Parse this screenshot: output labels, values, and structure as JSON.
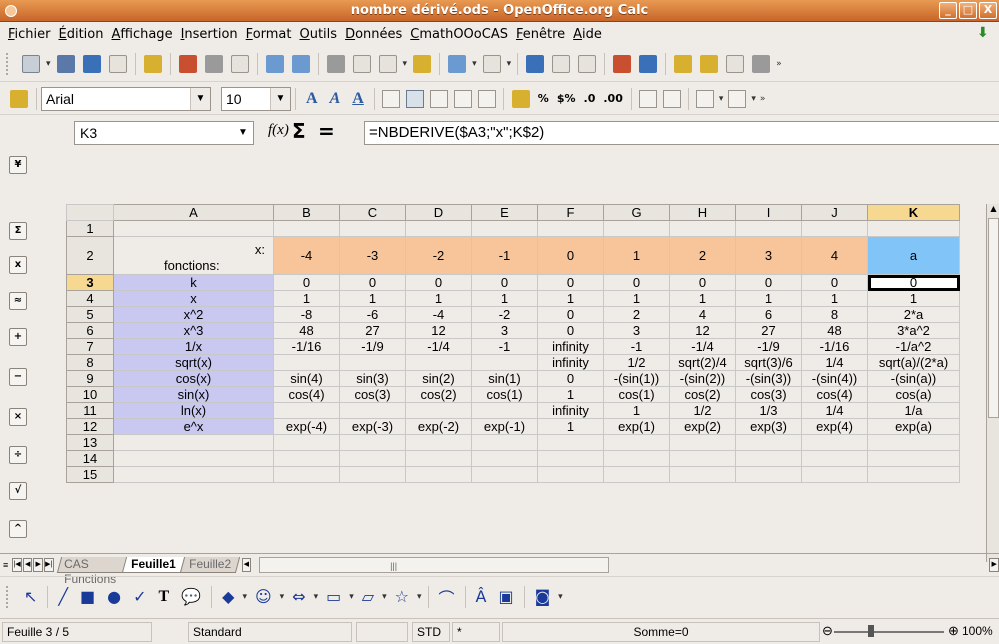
{
  "window": {
    "title": "nombre dérivé.ods - OpenOffice.org Calc",
    "buttons": [
      "_",
      "□",
      "X"
    ]
  },
  "menu": [
    "Fichier",
    "Édition",
    "Affichage",
    "Insertion",
    "Format",
    "Outils",
    "Données",
    "CmathOOoCAS",
    "Fenêtre",
    "Aide"
  ],
  "format": {
    "font": "Arial",
    "size": "10"
  },
  "formula": {
    "cell": "K3",
    "fx": "f(x)",
    "sigma": "Σ",
    "equals": "=",
    "content": "=NBDERIVE($A3;\"x\";K$2)"
  },
  "grid": {
    "columns": [
      "A",
      "B",
      "C",
      "D",
      "E",
      "F",
      "G",
      "H",
      "I",
      "J",
      "K"
    ],
    "row_labels": [
      "1",
      "2",
      "3",
      "4",
      "5",
      "6",
      "7",
      "8",
      "9",
      "10",
      "11",
      "12",
      "13",
      "14",
      "15"
    ],
    "a2_x": "x:",
    "a2_fonctions": "fonctions:",
    "row2": [
      "-4",
      "-3",
      "-2",
      "-1",
      "0",
      "1",
      "2",
      "3",
      "4",
      "a"
    ],
    "functions": [
      "k",
      "x",
      "x^2",
      "x^3",
      "1/x",
      "sqrt(x)",
      "cos(x)",
      "sin(x)",
      "ln(x)",
      "e^x"
    ],
    "values": [
      [
        "0",
        "0",
        "0",
        "0",
        "0",
        "0",
        "0",
        "0",
        "0",
        "0"
      ],
      [
        "1",
        "1",
        "1",
        "1",
        "1",
        "1",
        "1",
        "1",
        "1",
        "1"
      ],
      [
        "-8",
        "-6",
        "-4",
        "-2",
        "0",
        "2",
        "4",
        "6",
        "8",
        "2*a"
      ],
      [
        "48",
        "27",
        "12",
        "3",
        "0",
        "3",
        "12",
        "27",
        "48",
        "3*a^2"
      ],
      [
        "-1/16",
        "-1/9",
        "-1/4",
        "-1",
        "infinity",
        "-1",
        "-1/4",
        "-1/9",
        "-1/16",
        "-1/a^2"
      ],
      [
        "",
        "",
        "",
        "",
        "infinity",
        "1/2",
        "sqrt(2)/4",
        "sqrt(3)/6",
        "1/4",
        "sqrt(a)/(2*a)"
      ],
      [
        "sin(4)",
        "sin(3)",
        "sin(2)",
        "sin(1)",
        "0",
        "-(sin(1))",
        "-(sin(2))",
        "-(sin(3))",
        "-(sin(4))",
        "-(sin(a))"
      ],
      [
        "cos(4)",
        "cos(3)",
        "cos(2)",
        "cos(1)",
        "1",
        "cos(1)",
        "cos(2)",
        "cos(3)",
        "cos(4)",
        "cos(a)"
      ],
      [
        "",
        "",
        "",
        "",
        "infinity",
        "1",
        "1/2",
        "1/3",
        "1/4",
        "1/a"
      ],
      [
        "exp(-4)",
        "exp(-3)",
        "exp(-2)",
        "exp(-1)",
        "1",
        "exp(1)",
        "exp(2)",
        "exp(3)",
        "exp(4)",
        "exp(a)"
      ]
    ]
  },
  "sheets": {
    "tabs": [
      "CAS Functions",
      "Feuille1",
      "Feuille2"
    ],
    "active": "Feuille1"
  },
  "status": {
    "sheet": "Feuille 3 / 5",
    "style": "Standard",
    "mode": "STD",
    "modified": "*",
    "sum": "Somme=0",
    "zoom": "100%"
  }
}
